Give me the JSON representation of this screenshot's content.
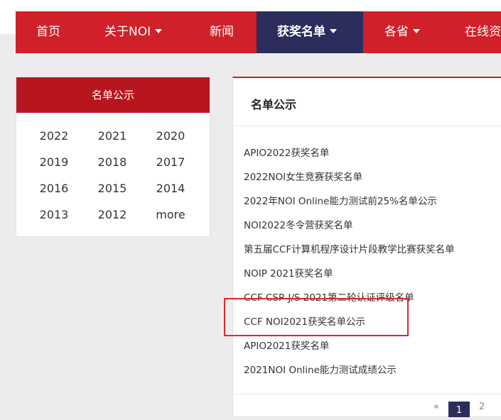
{
  "nav": {
    "items": [
      {
        "label": "首页"
      },
      {
        "label": "关于NOI"
      },
      {
        "label": "新闻"
      },
      {
        "label": "获奖名单"
      },
      {
        "label": "各省"
      },
      {
        "label": "在线资"
      }
    ]
  },
  "sidebar": {
    "title": "名单公示",
    "years": [
      "2022",
      "2021",
      "2020",
      "2019",
      "2018",
      "2017",
      "2016",
      "2015",
      "2014",
      "2013",
      "2012",
      "more"
    ]
  },
  "main": {
    "title": "名单公示",
    "items": [
      "APIO2022获奖名单",
      "2022NOI女生竞赛获奖名单",
      "2022年NOI Online能力测试前25%名单公示",
      "NOI2022冬令营获奖名单",
      "第五届CCF计算机程序设计片段教学比赛获奖名单",
      "NOIP 2021获奖名单",
      "CCF CSP-J/S 2021第二轮认证评级名单",
      "CCF NOI2021获奖名单公示",
      "APIO2021获奖名单",
      "2021NOI Online能力测试成绩公示"
    ]
  },
  "pagination": {
    "prev": "«",
    "pages": [
      "1",
      "2"
    ]
  },
  "colors": {
    "nav_red": "#d0202a",
    "nav_active": "#2b2e5c",
    "sidebar_header": "#b8161e",
    "highlight_box": "#e0262b"
  }
}
